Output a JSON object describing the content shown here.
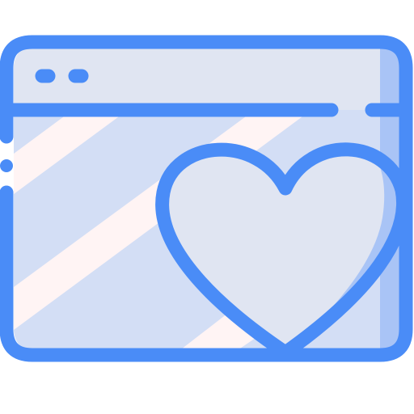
{
  "icon": {
    "name": "browser-window-heart-icon",
    "colors": {
      "outline": "#4A8CF7",
      "window_fill": "#D3DEF5",
      "titlebar_fill": "#E0E5F2",
      "right_shade": "#A9C4F6",
      "stripe": "#FFF4F4",
      "heart_fill": "#E0E5F2",
      "heart_shade": "#A9C4F6"
    },
    "titlebar_dots": 2
  }
}
